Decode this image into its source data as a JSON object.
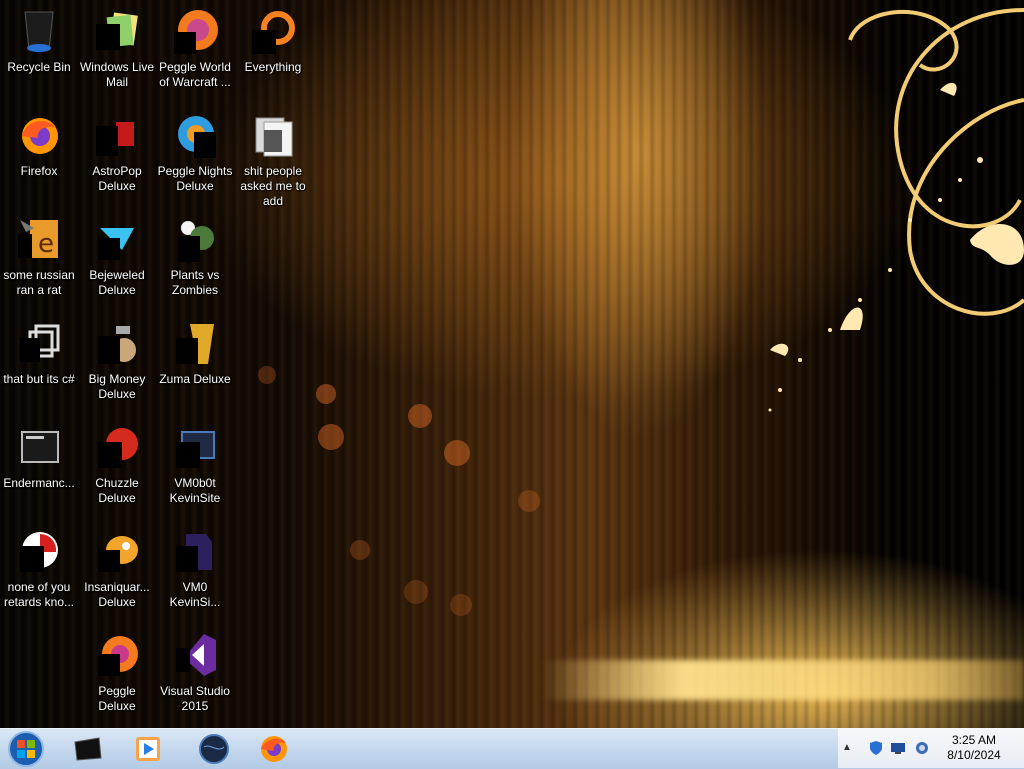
{
  "desktop_icons": [
    {
      "label": "Recycle Bin",
      "icon": "recycle-bin-icon"
    },
    {
      "label": "Windows Live Mail",
      "icon": "windows-live-mail-icon"
    },
    {
      "label": "Peggle World of Warcraft ...",
      "icon": "peggle-world-of-warcraft-icon"
    },
    {
      "label": "Everything",
      "icon": "everything-search-icon"
    },
    {
      "label": "Firefox",
      "icon": "firefox-icon"
    },
    {
      "label": "AstroPop Deluxe",
      "icon": "astropop-deluxe-icon"
    },
    {
      "label": "Peggle Nights Deluxe",
      "icon": "peggle-nights-deluxe-icon"
    },
    {
      "label": "shit people asked me to add",
      "icon": "folder-icon"
    },
    {
      "label": "some russian ran a rat",
      "icon": "shortcut-e-icon"
    },
    {
      "label": "Bejeweled Deluxe",
      "icon": "bejeweled-deluxe-icon"
    },
    {
      "label": "Plants vs Zombies",
      "icon": "plants-vs-zombies-icon"
    },
    {
      "label": "that but its c#",
      "icon": "window-stack-icon"
    },
    {
      "label": "Big Money Deluxe",
      "icon": "big-money-deluxe-icon"
    },
    {
      "label": "Zuma Deluxe",
      "icon": "zuma-deluxe-icon"
    },
    {
      "label": "Endermanc...",
      "icon": "terminal-window-icon"
    },
    {
      "label": "Chuzzle Deluxe",
      "icon": "chuzzle-deluxe-icon"
    },
    {
      "label": "VM0b0t KevinSite",
      "icon": "vm-kevinsite-icon"
    },
    {
      "label": "none of you retards kno...",
      "icon": "red-swirl-icon"
    },
    {
      "label": "Insaniquar... Deluxe",
      "icon": "insaniquarium-deluxe-icon"
    },
    {
      "label": "VM0 KevinSi...",
      "icon": "vm0-kevinsite-icon"
    },
    {
      "label": "Peggle Deluxe",
      "icon": "peggle-deluxe-icon"
    },
    {
      "label": "Visual Studio 2015",
      "icon": "visual-studio-2015-icon"
    }
  ],
  "taskbar": {
    "start_button": "windows-orb-icon",
    "pinned": [
      {
        "icon": "tablet-device-icon"
      },
      {
        "icon": "media-player-icon"
      },
      {
        "icon": "dark-globe-icon"
      },
      {
        "icon": "firefox-icon"
      }
    ]
  },
  "tray": {
    "overflow_arrow": "▲",
    "icons": [
      "security-shield-icon",
      "network-icon",
      "volume-icon"
    ],
    "time": "3:25 AM",
    "date": "8/10/2024"
  }
}
